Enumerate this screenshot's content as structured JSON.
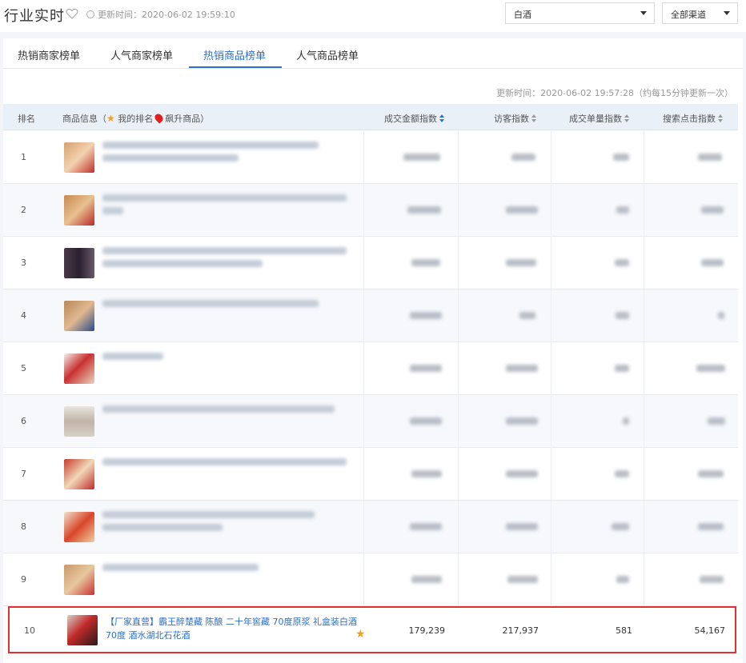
{
  "header": {
    "title": "行业实时",
    "update_time": "更新时间：2020-06-02 19:59:10",
    "category_select": "白酒",
    "channel_select": "全部渠道"
  },
  "tabs": [
    {
      "label": "热销商家榜单",
      "active": false
    },
    {
      "label": "人气商家榜单",
      "active": false
    },
    {
      "label": "热销商品榜单",
      "active": true
    },
    {
      "label": "人气商品榜单",
      "active": false
    }
  ],
  "table": {
    "update_note": "更新时间：2020-06-02 19:57:28（约每15分钟更新一次）",
    "columns": {
      "rank": "排名",
      "info_prefix": "商品信息（",
      "my_rank": "我的排名",
      "rising": "飙升商品）",
      "gmv": "成交金额指数",
      "visitors": "访客指数",
      "orders": "成交单量指数",
      "search": "搜索点击指数"
    },
    "ranks": [
      "1",
      "2",
      "3",
      "4",
      "5",
      "6",
      "7",
      "8",
      "9"
    ],
    "highlight_row": {
      "rank": "10",
      "name": "【厂家直营】霸王醉楚藏 陈酿 二十年窖藏 70度原浆 礼盒装白酒 70度 酒水湖北石花酒",
      "gmv": "179,239",
      "visitors": "217,937",
      "orders": "581",
      "search": "54,167"
    }
  },
  "colors": {
    "accent": "#2f6fc4",
    "highlight_border": "#e03030",
    "star": "#f0a020"
  }
}
